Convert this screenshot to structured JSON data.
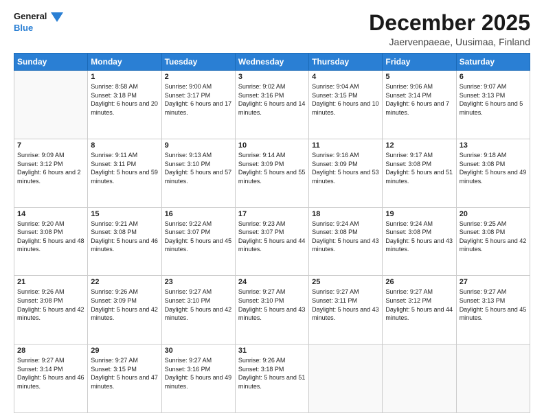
{
  "header": {
    "logo_line1": "General",
    "logo_line2": "Blue",
    "month_title": "December 2025",
    "location": "Jaervenpaeae, Uusimaa, Finland"
  },
  "weekdays": [
    "Sunday",
    "Monday",
    "Tuesday",
    "Wednesday",
    "Thursday",
    "Friday",
    "Saturday"
  ],
  "weeks": [
    [
      {
        "day": "",
        "sunrise": "",
        "sunset": "",
        "daylight": ""
      },
      {
        "day": "1",
        "sunrise": "Sunrise: 8:58 AM",
        "sunset": "Sunset: 3:18 PM",
        "daylight": "Daylight: 6 hours and 20 minutes."
      },
      {
        "day": "2",
        "sunrise": "Sunrise: 9:00 AM",
        "sunset": "Sunset: 3:17 PM",
        "daylight": "Daylight: 6 hours and 17 minutes."
      },
      {
        "day": "3",
        "sunrise": "Sunrise: 9:02 AM",
        "sunset": "Sunset: 3:16 PM",
        "daylight": "Daylight: 6 hours and 14 minutes."
      },
      {
        "day": "4",
        "sunrise": "Sunrise: 9:04 AM",
        "sunset": "Sunset: 3:15 PM",
        "daylight": "Daylight: 6 hours and 10 minutes."
      },
      {
        "day": "5",
        "sunrise": "Sunrise: 9:06 AM",
        "sunset": "Sunset: 3:14 PM",
        "daylight": "Daylight: 6 hours and 7 minutes."
      },
      {
        "day": "6",
        "sunrise": "Sunrise: 9:07 AM",
        "sunset": "Sunset: 3:13 PM",
        "daylight": "Daylight: 6 hours and 5 minutes."
      }
    ],
    [
      {
        "day": "7",
        "sunrise": "Sunrise: 9:09 AM",
        "sunset": "Sunset: 3:12 PM",
        "daylight": "Daylight: 6 hours and 2 minutes."
      },
      {
        "day": "8",
        "sunrise": "Sunrise: 9:11 AM",
        "sunset": "Sunset: 3:11 PM",
        "daylight": "Daylight: 5 hours and 59 minutes."
      },
      {
        "day": "9",
        "sunrise": "Sunrise: 9:13 AM",
        "sunset": "Sunset: 3:10 PM",
        "daylight": "Daylight: 5 hours and 57 minutes."
      },
      {
        "day": "10",
        "sunrise": "Sunrise: 9:14 AM",
        "sunset": "Sunset: 3:09 PM",
        "daylight": "Daylight: 5 hours and 55 minutes."
      },
      {
        "day": "11",
        "sunrise": "Sunrise: 9:16 AM",
        "sunset": "Sunset: 3:09 PM",
        "daylight": "Daylight: 5 hours and 53 minutes."
      },
      {
        "day": "12",
        "sunrise": "Sunrise: 9:17 AM",
        "sunset": "Sunset: 3:08 PM",
        "daylight": "Daylight: 5 hours and 51 minutes."
      },
      {
        "day": "13",
        "sunrise": "Sunrise: 9:18 AM",
        "sunset": "Sunset: 3:08 PM",
        "daylight": "Daylight: 5 hours and 49 minutes."
      }
    ],
    [
      {
        "day": "14",
        "sunrise": "Sunrise: 9:20 AM",
        "sunset": "Sunset: 3:08 PM",
        "daylight": "Daylight: 5 hours and 48 minutes."
      },
      {
        "day": "15",
        "sunrise": "Sunrise: 9:21 AM",
        "sunset": "Sunset: 3:08 PM",
        "daylight": "Daylight: 5 hours and 46 minutes."
      },
      {
        "day": "16",
        "sunrise": "Sunrise: 9:22 AM",
        "sunset": "Sunset: 3:07 PM",
        "daylight": "Daylight: 5 hours and 45 minutes."
      },
      {
        "day": "17",
        "sunrise": "Sunrise: 9:23 AM",
        "sunset": "Sunset: 3:07 PM",
        "daylight": "Daylight: 5 hours and 44 minutes."
      },
      {
        "day": "18",
        "sunrise": "Sunrise: 9:24 AM",
        "sunset": "Sunset: 3:08 PM",
        "daylight": "Daylight: 5 hours and 43 minutes."
      },
      {
        "day": "19",
        "sunrise": "Sunrise: 9:24 AM",
        "sunset": "Sunset: 3:08 PM",
        "daylight": "Daylight: 5 hours and 43 minutes."
      },
      {
        "day": "20",
        "sunrise": "Sunrise: 9:25 AM",
        "sunset": "Sunset: 3:08 PM",
        "daylight": "Daylight: 5 hours and 42 minutes."
      }
    ],
    [
      {
        "day": "21",
        "sunrise": "Sunrise: 9:26 AM",
        "sunset": "Sunset: 3:08 PM",
        "daylight": "Daylight: 5 hours and 42 minutes."
      },
      {
        "day": "22",
        "sunrise": "Sunrise: 9:26 AM",
        "sunset": "Sunset: 3:09 PM",
        "daylight": "Daylight: 5 hours and 42 minutes."
      },
      {
        "day": "23",
        "sunrise": "Sunrise: 9:27 AM",
        "sunset": "Sunset: 3:10 PM",
        "daylight": "Daylight: 5 hours and 42 minutes."
      },
      {
        "day": "24",
        "sunrise": "Sunrise: 9:27 AM",
        "sunset": "Sunset: 3:10 PM",
        "daylight": "Daylight: 5 hours and 43 minutes."
      },
      {
        "day": "25",
        "sunrise": "Sunrise: 9:27 AM",
        "sunset": "Sunset: 3:11 PM",
        "daylight": "Daylight: 5 hours and 43 minutes."
      },
      {
        "day": "26",
        "sunrise": "Sunrise: 9:27 AM",
        "sunset": "Sunset: 3:12 PM",
        "daylight": "Daylight: 5 hours and 44 minutes."
      },
      {
        "day": "27",
        "sunrise": "Sunrise: 9:27 AM",
        "sunset": "Sunset: 3:13 PM",
        "daylight": "Daylight: 5 hours and 45 minutes."
      }
    ],
    [
      {
        "day": "28",
        "sunrise": "Sunrise: 9:27 AM",
        "sunset": "Sunset: 3:14 PM",
        "daylight": "Daylight: 5 hours and 46 minutes."
      },
      {
        "day": "29",
        "sunrise": "Sunrise: 9:27 AM",
        "sunset": "Sunset: 3:15 PM",
        "daylight": "Daylight: 5 hours and 47 minutes."
      },
      {
        "day": "30",
        "sunrise": "Sunrise: 9:27 AM",
        "sunset": "Sunset: 3:16 PM",
        "daylight": "Daylight: 5 hours and 49 minutes."
      },
      {
        "day": "31",
        "sunrise": "Sunrise: 9:26 AM",
        "sunset": "Sunset: 3:18 PM",
        "daylight": "Daylight: 5 hours and 51 minutes."
      },
      {
        "day": "",
        "sunrise": "",
        "sunset": "",
        "daylight": ""
      },
      {
        "day": "",
        "sunrise": "",
        "sunset": "",
        "daylight": ""
      },
      {
        "day": "",
        "sunrise": "",
        "sunset": "",
        "daylight": ""
      }
    ]
  ]
}
